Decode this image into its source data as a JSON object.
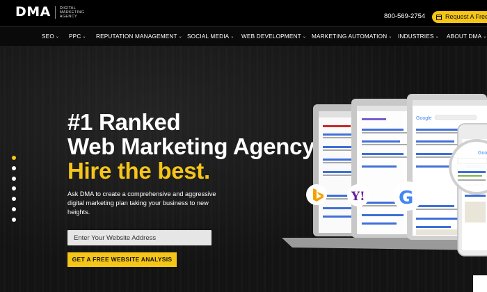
{
  "header": {
    "logo": {
      "mark": "DMA",
      "tagline": "Digital Marketing Agency"
    },
    "phone": "800-569-2754",
    "quote_button": "Request A Free Q"
  },
  "nav": {
    "items": [
      {
        "label": "SEO"
      },
      {
        "label": "PPC"
      },
      {
        "label": "REPUTATION MANAGEMENT"
      },
      {
        "label": "SOCIAL MEDIA"
      },
      {
        "label": "WEB DEVELOPMENT"
      },
      {
        "label": "MARKETING AUTOMATION"
      },
      {
        "label": "INDUSTRIES"
      },
      {
        "label": "ABOUT DMA"
      }
    ],
    "caret": "⌄"
  },
  "hero": {
    "headline_line1": "#1 Ranked",
    "headline_line2": "Web Marketing Agency",
    "headline_line3": "Hire the best.",
    "subtext": "Ask DMA to create a comprehensive and aggressive digital marketing plan taking your business to new heights.",
    "input_placeholder": "Enter Your Website Address",
    "cta_label": "GET A FREE WEBSITE ANALYSIS",
    "slider": {
      "count": 7,
      "active_index": 0
    }
  },
  "illustration": {
    "logos": [
      "bing-icon",
      "yahoo-icon",
      "google-icon"
    ],
    "yahoo_text": "Y!",
    "google_text": "G",
    "colors": {
      "accent": "#f5c518",
      "bing": "#f4a000",
      "yahoo": "#6a1b9a"
    }
  }
}
